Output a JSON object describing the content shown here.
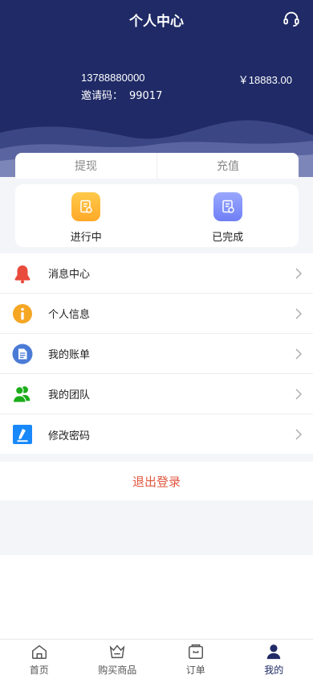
{
  "header": {
    "title": "个人中心",
    "phone": "13788880000",
    "invite_label": "邀请码：",
    "invite_code": "99017",
    "balance": "￥18883.00",
    "bg_color": "#1f2a66"
  },
  "tabs": [
    {
      "label": "提现"
    },
    {
      "label": "充值"
    }
  ],
  "status": [
    {
      "label": "进行中",
      "icon": "document-clock-icon",
      "color": "#ffb43a"
    },
    {
      "label": "已完成",
      "icon": "document-check-icon",
      "color": "#7b88f7"
    }
  ],
  "menu": [
    {
      "label": "消息中心",
      "icon": "bell-icon",
      "color": "#e94b3c"
    },
    {
      "label": "个人信息",
      "icon": "info-icon",
      "color": "#f5a623"
    },
    {
      "label": "我的账单",
      "icon": "bill-icon",
      "color": "#4a7bd6"
    },
    {
      "label": "我的团队",
      "icon": "team-icon",
      "color": "#1aad19"
    },
    {
      "label": "修改密码",
      "icon": "edit-icon",
      "color": "#1989fa"
    }
  ],
  "logout_label": "退出登录",
  "tabbar": [
    {
      "label": "首页",
      "icon": "home-icon"
    },
    {
      "label": "购买商品",
      "icon": "crown-basket-icon"
    },
    {
      "label": "订单",
      "icon": "wallet-icon"
    },
    {
      "label": "我的",
      "icon": "user-icon",
      "active": true
    }
  ]
}
